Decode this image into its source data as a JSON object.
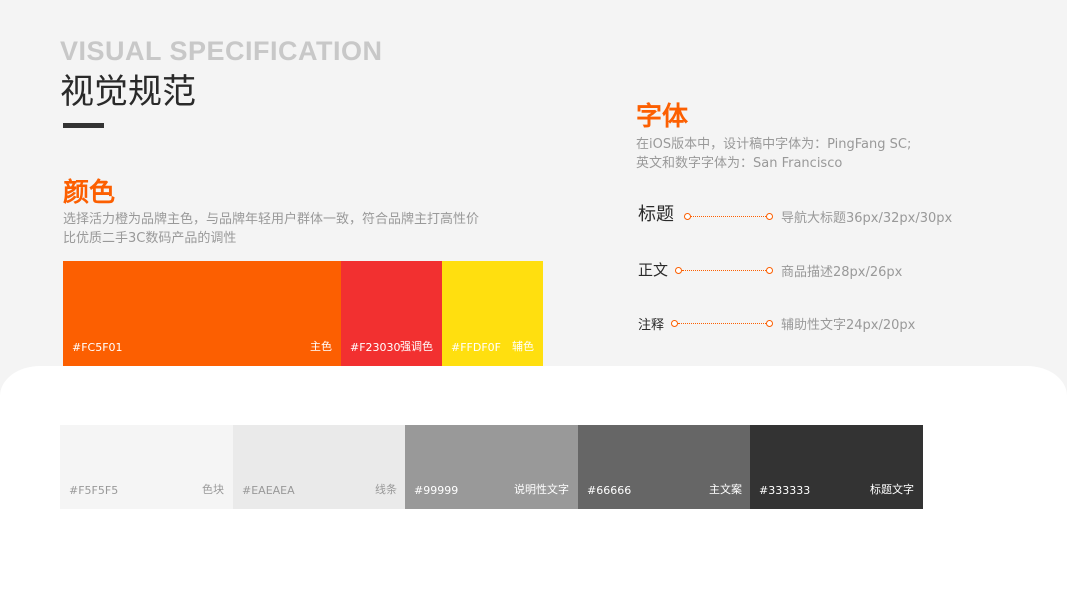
{
  "header": {
    "eyebrow": "VISUAL SPECIFICATION",
    "title": "视觉规范"
  },
  "color_section": {
    "title": "颜色",
    "description": "选择活力橙为品牌主色，与品牌年轻用户群体一致，符合品牌主打高性价比优质二手3C数码产品的调性",
    "brand_swatches": [
      {
        "hex": "#FC5F01",
        "name": "主色",
        "color": "#FC5F01"
      },
      {
        "hex": "#F23030",
        "name": "强调色",
        "color": "#F23030"
      },
      {
        "hex": "#FFDF0F",
        "name": "辅色",
        "color": "#FFDF0F"
      }
    ],
    "neutral_swatches": [
      {
        "hex": "#F5F5F5",
        "name": "色块",
        "color": "#F5F5F5"
      },
      {
        "hex": "#EAEAEA",
        "name": "线条",
        "color": "#EAEAEA"
      },
      {
        "hex": "#99999",
        "name": "说明性文字",
        "color": "#999999"
      },
      {
        "hex": "#66666",
        "name": "主文案",
        "color": "#666666"
      },
      {
        "hex": "#333333",
        "name": "标题文字",
        "color": "#333333"
      }
    ]
  },
  "font_section": {
    "title": "字体",
    "description_line1": "在iOS版本中，设计稿中字体为：PingFang SC;",
    "description_line2": "英文和数字字体为：San Francisco",
    "rows": [
      {
        "label": "标题",
        "spec": "导航大标题36px/32px/30px"
      },
      {
        "label": "正文",
        "spec": "商品描述28px/26px"
      },
      {
        "label": "注释",
        "spec": "辅助性文字24px/20px"
      }
    ]
  }
}
